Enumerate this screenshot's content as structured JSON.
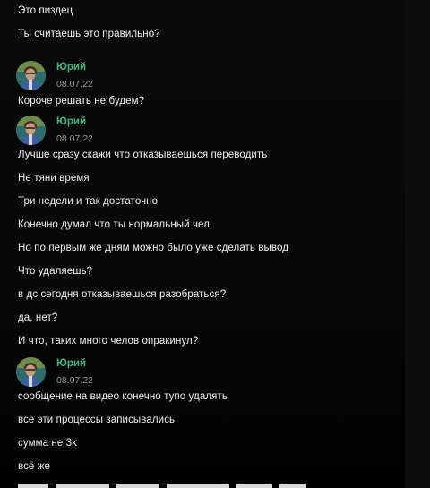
{
  "colors": {
    "background": "#060606",
    "text": "#f2f2f2",
    "author": "#43b581",
    "timestamp": "#9a9a9a"
  },
  "messages_top": [
    "Это пиздец",
    "Ты считаешь это правильно?"
  ],
  "groups": [
    {
      "author": "Юрий",
      "timestamp": "08.07.22",
      "avatar_icon": "user-avatar",
      "messages": [
        "Короче решать не будем?"
      ]
    },
    {
      "author": "Юрий",
      "timestamp": "08.07.22",
      "avatar_icon": "user-avatar",
      "messages": [
        "Лучше сразу скажи что отказываешься переводить",
        "Не тяни время",
        "Три недели и так достаточно",
        "Конечно думал что ты нормальный чел",
        "Но по первым же дням можно было уже сделать вывод",
        "Что удаляешь?",
        "в дс сегодня отказываешься разобраться?",
        "да, нет?",
        "И что, таких много челов опракинул?"
      ]
    },
    {
      "author": "Юрий",
      "timestamp": "08.07.22",
      "avatar_icon": "user-avatar",
      "messages": [
        "сообщение на видео конечно тупо удалять",
        "все эти процессы записывались",
        "сумма не 3k",
        "всё же"
      ]
    }
  ]
}
